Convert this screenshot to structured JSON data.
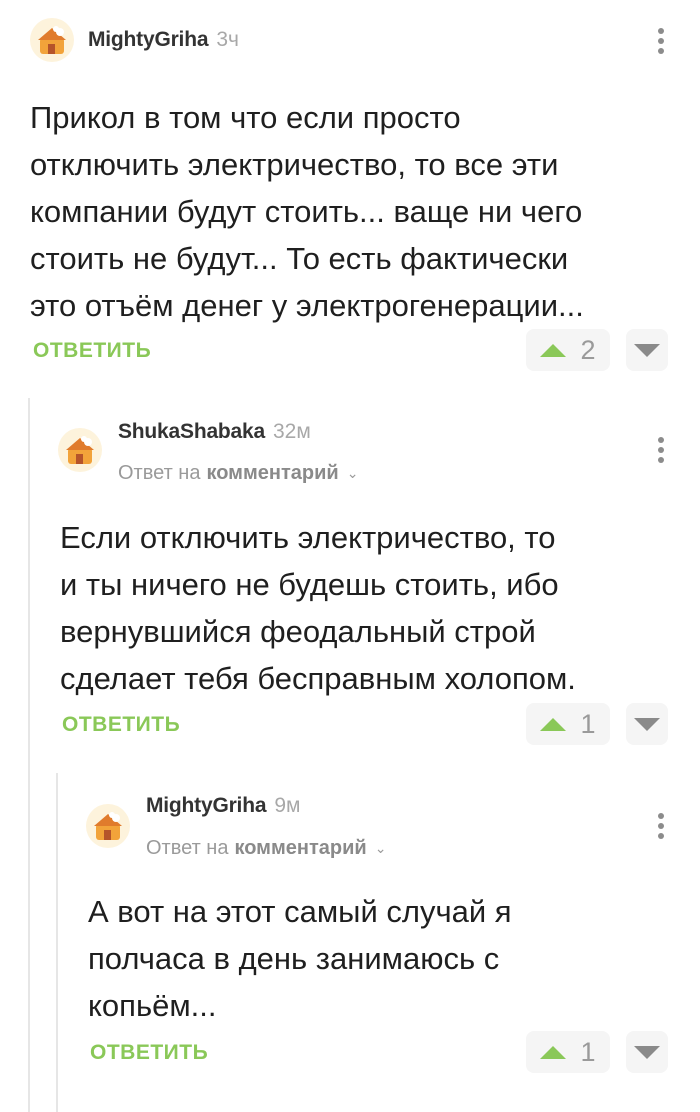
{
  "comments": [
    {
      "author": "MightyGriha",
      "time": "3ч",
      "text_lines": [
        "Прикол в том что если просто",
        "отключить электричество, то все эти",
        "компании будут стоить... ваще ни чего",
        "стоить не будут... То есть фактически",
        "это отъём денег у электрогенерации..."
      ],
      "reply_label": "ОТВЕТИТЬ",
      "votes": "2"
    },
    {
      "author": "ShukaShabaka",
      "time": "32м",
      "reply_to_prefix": "Ответ на",
      "reply_to_target": "комментарий",
      "text_lines": [
        "Если отключить электричество, то",
        "и ты ничего не будешь стоить, ибо",
        "вернувшийся феодальный строй",
        "сделает тебя бесправным холопом."
      ],
      "reply_label": "ОТВЕТИТЬ",
      "votes": "1"
    },
    {
      "author": "MightyGriha",
      "time": "9м",
      "reply_to_prefix": "Ответ на",
      "reply_to_target": "комментарий",
      "text_lines": [
        "А вот на этот самый случай я",
        "полчаса в день занимаюсь с",
        "копьём..."
      ],
      "reply_label": "ОТВЕТИТЬ",
      "votes": "1"
    }
  ],
  "icons": {
    "avatar": "avatar-house-icon",
    "more": "more-vertical-icon",
    "upvote": "upvote-arrow-icon",
    "downvote": "downvote-arrow-icon",
    "chevron": "chevron-down-icon"
  },
  "colors": {
    "accent_green": "#8ac858",
    "thread_line": "#e6e6e6"
  }
}
